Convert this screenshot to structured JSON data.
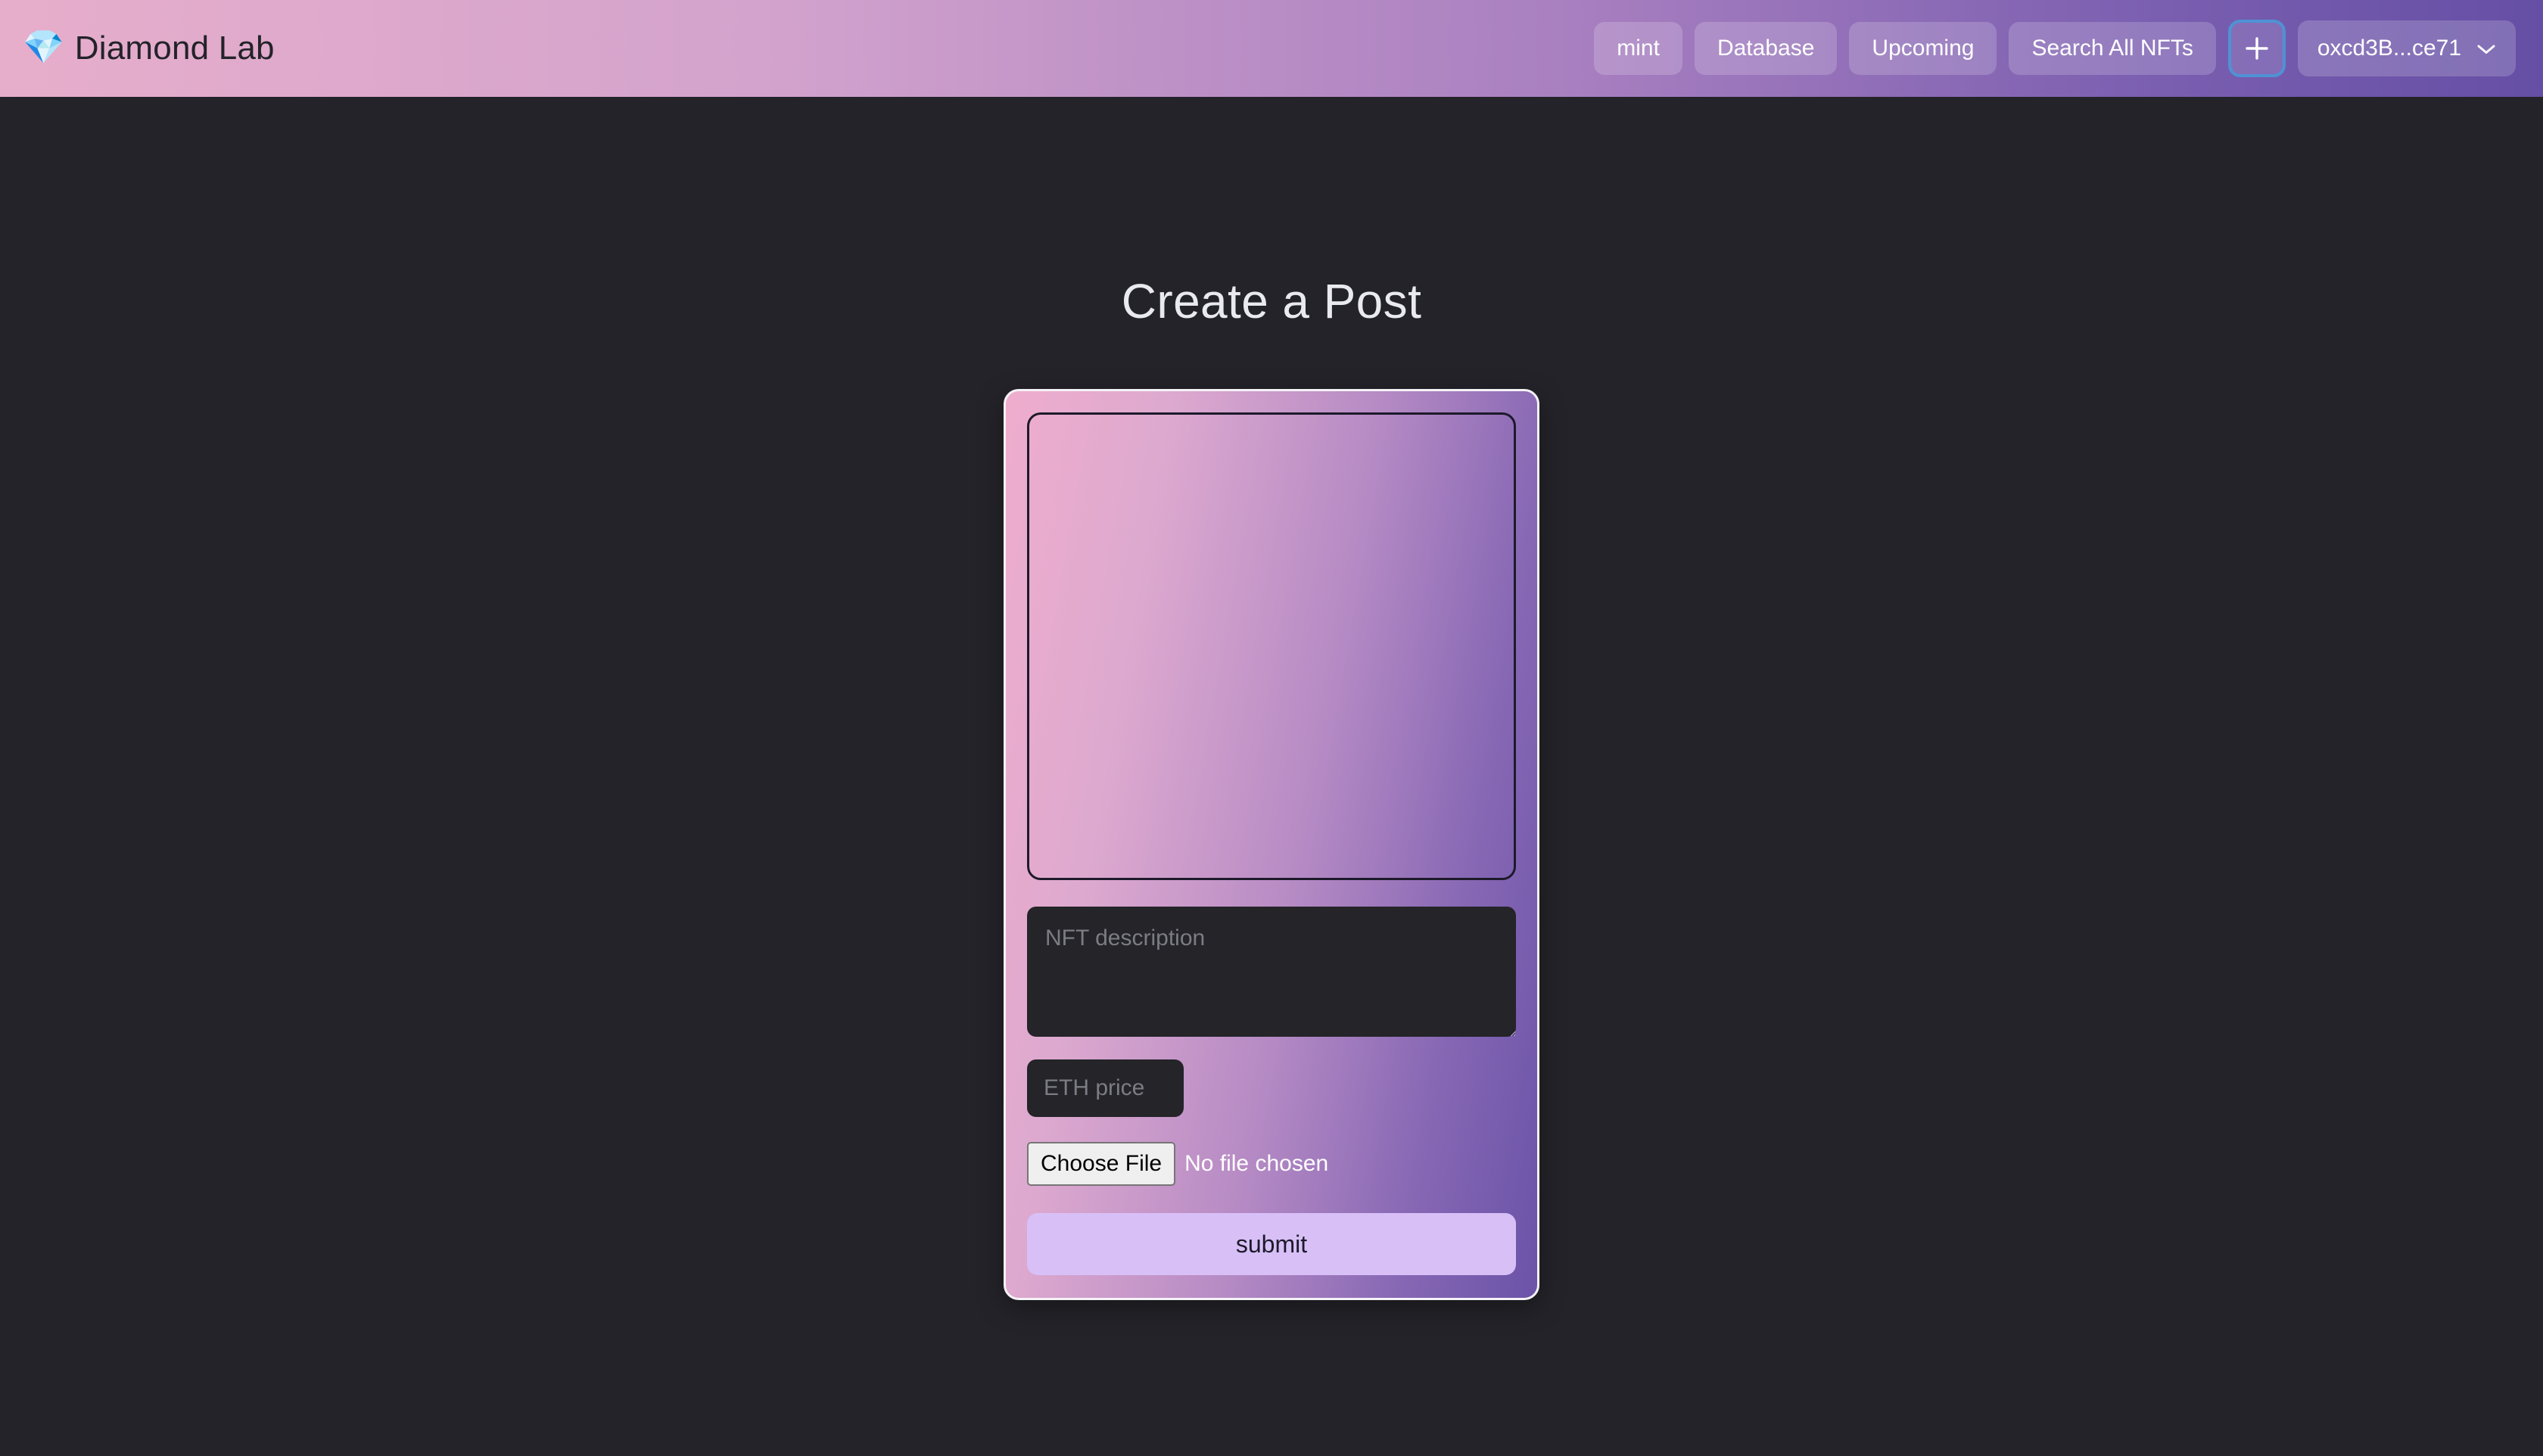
{
  "header": {
    "brand": {
      "logo_icon": "diamond-icon",
      "logo_glyph": "💎",
      "name": "Diamond Lab"
    },
    "nav_items": [
      {
        "label": "mint"
      },
      {
        "label": "Database"
      },
      {
        "label": "Upcoming"
      },
      {
        "label": "Search All NFTs"
      }
    ],
    "add_button": {
      "icon": "plus-icon",
      "label": "+"
    },
    "wallet": {
      "address": "oxcd3B...ce71",
      "chevron_icon": "chevron-down-icon"
    },
    "gradient_from": "#e7aecb",
    "gradient_to": "#654fa5"
  },
  "main": {
    "title": "Create a Post",
    "card": {
      "image_preview": {
        "name": "nft-image-preview",
        "value": ""
      },
      "description": {
        "placeholder": "NFT description",
        "value": ""
      },
      "price": {
        "placeholder": "ETH price",
        "value": ""
      },
      "file": {
        "button_label": "Choose File",
        "status": "No file chosen"
      },
      "submit_label": "submit",
      "submit_color": "#d8c0f7",
      "gradient_from": "#efadcd",
      "gradient_to": "#6b53a8"
    }
  },
  "colors": {
    "page_background": "#232329",
    "title_text": "#e9eaee",
    "field_background": "#242429",
    "placeholder_text": "#7c7c84",
    "focus_ring": "#4f92d4"
  }
}
